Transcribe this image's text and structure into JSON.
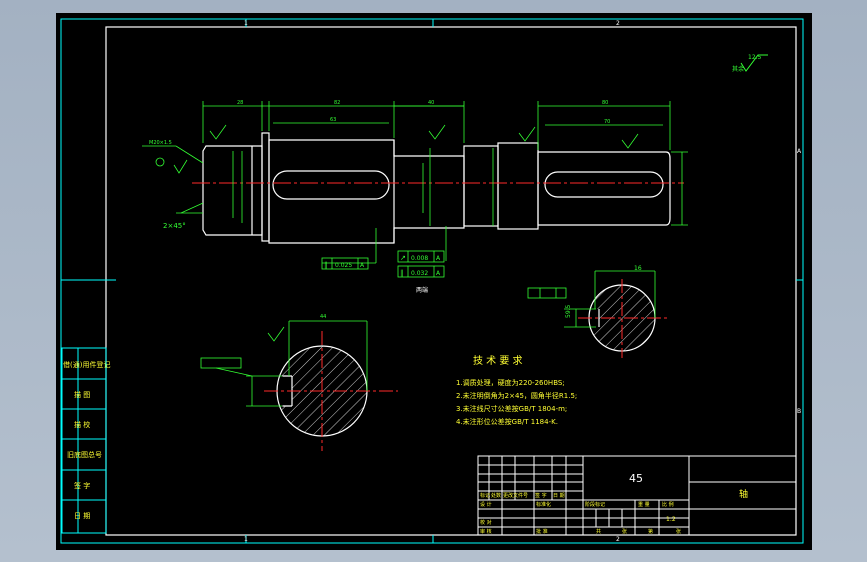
{
  "colors": {
    "background": "#a9b6c6",
    "paper": "#000000",
    "frame": "#00ffff",
    "outline": "#ffffff",
    "dimension": "#33ff33",
    "centerline": "#ff2a2a",
    "hatch": "#ffffff",
    "note_text": "#ffff33"
  },
  "zones": {
    "top": [
      "1",
      "2"
    ],
    "bottom": [
      "1",
      "2"
    ],
    "right": [
      "A",
      "B"
    ]
  },
  "roughness": {
    "note": "其余",
    "value": "12.5"
  },
  "dims": {
    "chamfer": "2×45°",
    "keyway_right_width": "16",
    "key_depth_right": "59.5"
  },
  "tolerance_frames": [
    {
      "sym": "∥",
      "val": "0.025",
      "ref": "A"
    },
    {
      "sym": "↗",
      "val": "0.008",
      "ref": "A"
    },
    {
      "sym": "∥",
      "val": "0.032",
      "ref": "A"
    }
  ],
  "section_label": "两端",
  "notes": {
    "title": "技 术 要 求",
    "items": [
      "1.调质处理，硬度为220-260HBS;",
      "2.未注明倒角为2×45，圆角半径R1.5;",
      "3.未注线尺寸公差按GB/T 1804-m;",
      "4.未注形位公差按GB/T 1184-K."
    ]
  },
  "side_table": [
    "借(通)用件登记",
    "描 图",
    "描 校",
    "旧底图总号",
    "签 字",
    "日 期"
  ],
  "title_block": {
    "material": "45",
    "part_name": "轴",
    "scale": "1:2",
    "header_cells": [
      "标记",
      "处数",
      "更改文件号",
      "签 字",
      "日 期"
    ],
    "stage_label": "阶段标记",
    "weight_label": "重 量",
    "scale_label": "比 例",
    "roles": [
      "设 计",
      "校 对",
      "审 核"
    ],
    "std_label": "标准化",
    "approve_label": "批 准",
    "sheet_labels": [
      "共",
      "张",
      "第",
      "张"
    ]
  }
}
